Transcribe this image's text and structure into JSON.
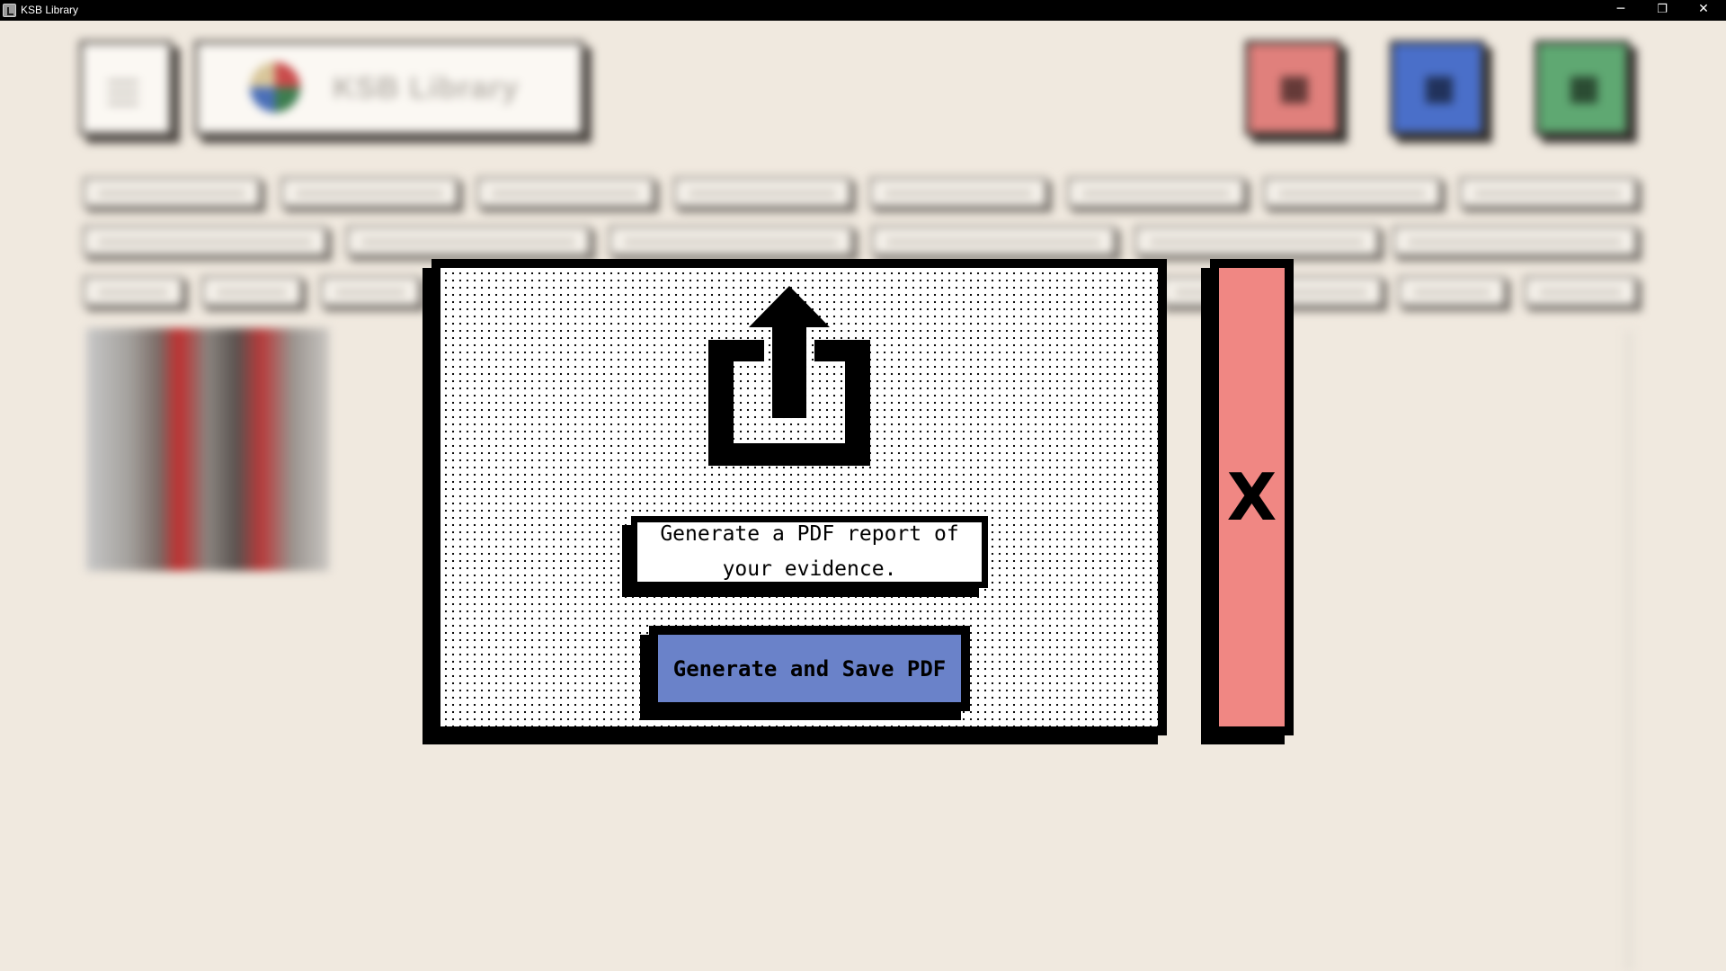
{
  "window": {
    "title": "KSB Library",
    "controls": {
      "minimize": "─",
      "restore": "❐",
      "close": "✕"
    }
  },
  "background": {
    "app_title": "KSB Library",
    "colors": {
      "background": "#f0e9df",
      "red": "#f08783",
      "blue": "#4a6fc9",
      "green": "#5fa872"
    }
  },
  "modal": {
    "icon": "upload-icon",
    "description": "Generate a PDF report of your evidence.",
    "generate_button": "Generate and Save PDF",
    "close_button": "X",
    "colors": {
      "button": "#6a82c9",
      "close": "#f08783"
    }
  }
}
